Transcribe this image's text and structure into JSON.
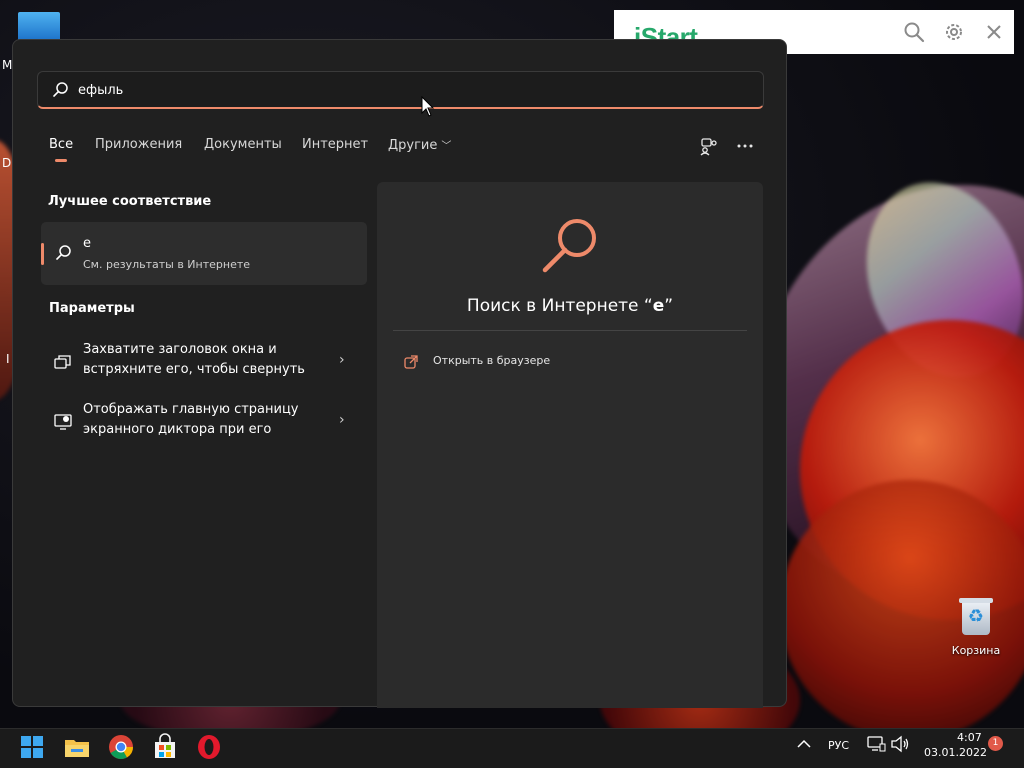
{
  "desktop": {
    "edge_letters": [
      "M",
      "D",
      "I"
    ],
    "recycle_bin_label": "Корзина"
  },
  "istart": {
    "logo": "iStart",
    "icons": [
      "search-icon",
      "gear-icon",
      "close-icon"
    ],
    "brand_color": "#27a86b"
  },
  "search": {
    "query": "ефыль",
    "accent_color": "#ee8a6a",
    "tabs": [
      {
        "label": "Все",
        "active": true
      },
      {
        "label": "Приложения",
        "active": false
      },
      {
        "label": "Документы",
        "active": false
      },
      {
        "label": "Интернет",
        "active": false
      },
      {
        "label": "Другие",
        "active": false,
        "has_dropdown": true
      }
    ],
    "toolbar_icons": [
      "people-search-icon",
      "more-icon"
    ],
    "best_match": {
      "section_title": "Лучшее соответствие",
      "title": "е",
      "subtitle": "См. результаты в Интернете"
    },
    "settings": {
      "section_title": "Параметры",
      "items": [
        {
          "label": "Захватите заголовок окна и встряхните его, чтобы свернуть",
          "icon": "window-shake-icon"
        },
        {
          "label": "Отображать главную страницу экранного диктора при его",
          "icon": "narrator-icon"
        }
      ]
    },
    "preview": {
      "title_prefix": "Поиск в Интернете “",
      "title_term": "е",
      "title_suffix": "”",
      "open_label": "Открыть в браузере"
    }
  },
  "taskbar": {
    "apps": [
      "windows-start-icon",
      "file-explorer-icon",
      "chrome-icon",
      "microsoft-store-icon",
      "opera-icon"
    ],
    "language": "РУС",
    "time": "4:07",
    "date": "03.01.2022",
    "notification_count": "1"
  }
}
